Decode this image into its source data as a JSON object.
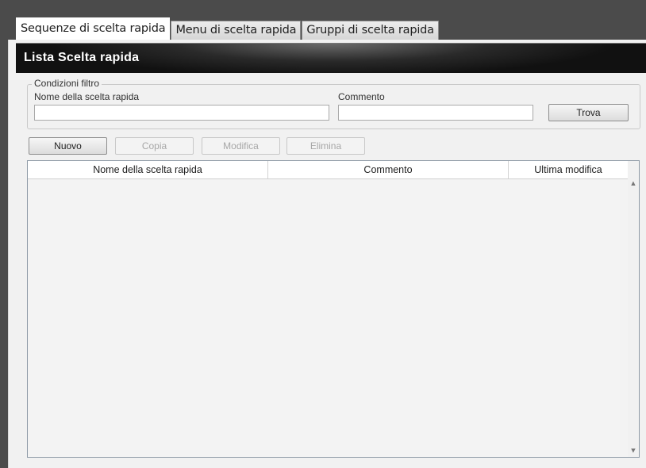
{
  "tabs": [
    {
      "label": "Sequenze di scelta rapida",
      "active": true
    },
    {
      "label": "Menu di scelta rapida",
      "active": false
    },
    {
      "label": "Gruppi di scelta rapida",
      "active": false
    }
  ],
  "header": {
    "title": "Lista Scelta rapida"
  },
  "filter": {
    "legend": "Condizioni filtro",
    "name_label": "Nome della scelta rapida",
    "name_value": "",
    "comment_label": "Commento",
    "comment_value": "",
    "search_button": "Trova"
  },
  "toolbar": {
    "new_label": "Nuovo",
    "copy_label": "Copia",
    "edit_label": "Modifica",
    "delete_label": "Elimina"
  },
  "table": {
    "columns": [
      "Nome della scelta rapida",
      "Commento",
      "Ultima modifica"
    ],
    "rows": []
  },
  "icons": {
    "scroll_up": "scroll-up-arrow-icon",
    "scroll_down": "scroll-down-arrow-icon"
  }
}
